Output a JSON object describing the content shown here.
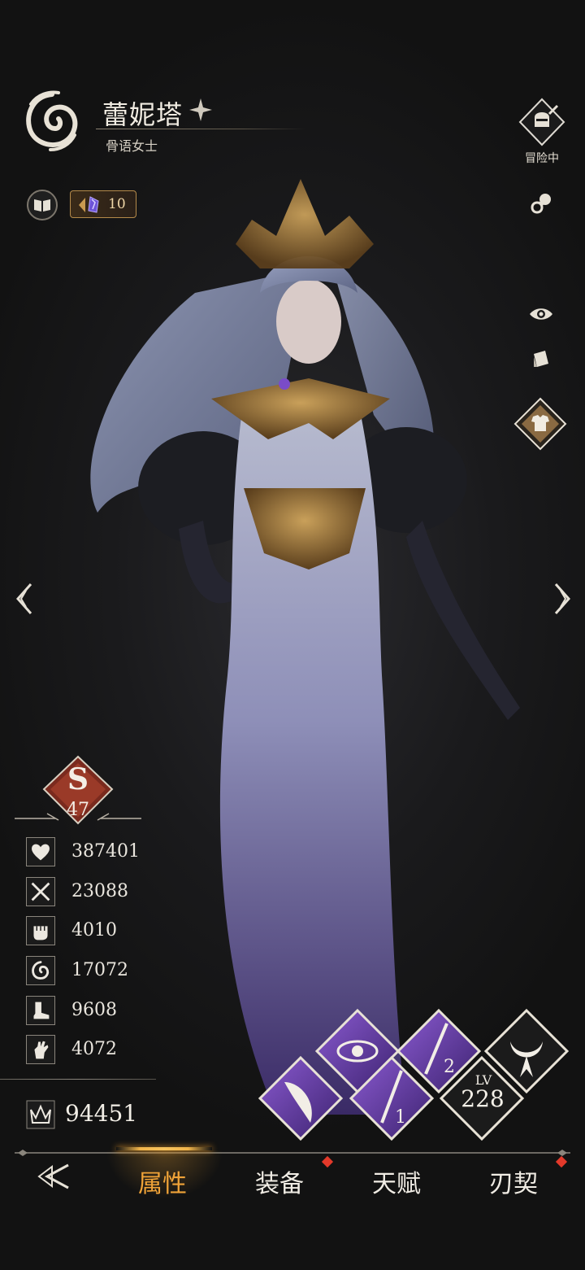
{
  "character": {
    "name": "蕾妮塔",
    "title": "骨语女士",
    "emblem_icon": "spiral-wind-emblem-icon",
    "star_icon": "four-point-star-icon"
  },
  "top_left": {
    "book_icon": "open-book-icon",
    "crystal_icon": "purple-crystal-icon",
    "crystal_count": "10"
  },
  "right_column": {
    "adventure_label": "冒险中",
    "adventure_icon": "knight-helmet-sword-icon",
    "pacifier_icon": "pacifier-icon",
    "eye_icon": "eye-icon",
    "card_icon": "card-icon",
    "outfit_icon": "tshirt-icon"
  },
  "rank": {
    "letter": "S",
    "value": "47"
  },
  "stats": [
    {
      "icon": "heart-hp-icon",
      "value": "387401"
    },
    {
      "icon": "sword-attack-icon",
      "value": "23088"
    },
    {
      "icon": "fist-icon",
      "value": "4010"
    },
    {
      "icon": "swirl-icon",
      "value": "17072"
    },
    {
      "icon": "boot-speed-icon",
      "value": "9608"
    },
    {
      "icon": "hand-icon",
      "value": "4072"
    }
  ],
  "power": {
    "icon": "crown-power-icon",
    "value": "94451"
  },
  "skills": {
    "items": [
      "spirit-eye-skill-icon",
      "dagger-2-skill-icon",
      "wing-skill-icon",
      "dagger-1-skill-icon",
      "horned-moon-skill-icon"
    ],
    "lv_label": "LV",
    "lv_value": "228"
  },
  "nav": {
    "tabs": [
      "属性",
      "装备",
      "天赋",
      "刃契"
    ],
    "active_tab": "属性",
    "back_icon": "back-arrow-icon"
  },
  "colors": {
    "accent_gold": "#f0a338",
    "skill_purple": "#6a3fa8",
    "notify_red": "#e3392a",
    "rank_red": "#8a2e22"
  }
}
